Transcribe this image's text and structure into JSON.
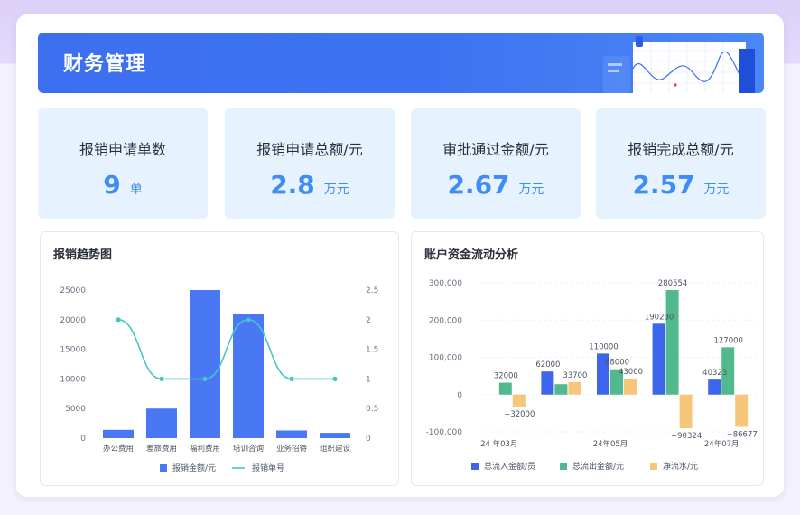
{
  "header": {
    "title": "财务管理"
  },
  "stats": [
    {
      "label": "报销申请单数",
      "value": "9",
      "unit": "单"
    },
    {
      "label": "报销申请总额/元",
      "value": "2.8",
      "unit": "万元"
    },
    {
      "label": "审批通过金额/元",
      "value": "2.67",
      "unit": "万元"
    },
    {
      "label": "报销完成总额/元",
      "value": "2.57",
      "unit": "万元"
    }
  ],
  "colors": {
    "bar_blue": "#4a78f4",
    "line_teal": "#45c6c6",
    "inflow": "#3e66ec",
    "outflow": "#52b98e",
    "net": "#f6c77b",
    "accent_text": "#3f8df3"
  },
  "chart_data": [
    {
      "type": "bar",
      "title": "报销趋势图",
      "categories": [
        "办公费用",
        "差旅费用",
        "福利费用",
        "培训咨询",
        "业务招待",
        "组织建设"
      ],
      "y_left_ticks": [
        "25000",
        "20000",
        "15000",
        "10000",
        "5000",
        "0"
      ],
      "y_right_ticks": [
        "2.5",
        "2",
        "1.5",
        "1",
        "0.5",
        "0"
      ],
      "ylim_left": [
        0,
        25000
      ],
      "ylim_right": [
        0,
        2.5
      ],
      "series": [
        {
          "name": "报销金额/元",
          "kind": "bar",
          "axis": "left",
          "values": [
            1400,
            5000,
            25000,
            21000,
            1300,
            900
          ]
        },
        {
          "name": "报销单号",
          "kind": "line",
          "axis": "right",
          "values": [
            2,
            1,
            1,
            2,
            1,
            1
          ]
        }
      ],
      "legend": "bottom"
    },
    {
      "type": "bar",
      "title": "账户资金流动分析",
      "categories": [
        "24年03月",
        "",
        "24年05月",
        "",
        "24年07月"
      ],
      "x_tick_labels": [
        "24 年03月",
        "24年05月",
        "24年07月"
      ],
      "y_ticks": [
        "300,000",
        "200,000",
        "100,000",
        "0",
        "-100,000"
      ],
      "ylim": [
        -100000,
        300000
      ],
      "series": [
        {
          "name": "总流入金额/员",
          "values": [
            0,
            62000,
            110000,
            190230,
            40323
          ]
        },
        {
          "name": "总流出金额/元",
          "values": [
            32000,
            28000,
            68000,
            280554,
            127000
          ]
        },
        {
          "name": "净流水/元",
          "values": [
            -32000,
            33700,
            43000,
            -90324,
            -86677
          ]
        }
      ],
      "data_labels": [
        {
          "group": 0,
          "series": 1,
          "text": "32000"
        },
        {
          "group": 0,
          "series": 2,
          "text": "−32000"
        },
        {
          "group": 1,
          "series": 0,
          "text": "62000"
        },
        {
          "group": 1,
          "series": 2,
          "text": "33700"
        },
        {
          "group": 2,
          "series": 0,
          "text": "110000"
        },
        {
          "group": 2,
          "series": 1,
          "text": "68000"
        },
        {
          "group": 2,
          "series": 2,
          "text": "43000"
        },
        {
          "group": 3,
          "series": 0,
          "text": "190230"
        },
        {
          "group": 3,
          "series": 1,
          "text": "280554"
        },
        {
          "group": 3,
          "series": 2,
          "text": "−90324"
        },
        {
          "group": 4,
          "series": 0,
          "text": "40323"
        },
        {
          "group": 4,
          "series": 1,
          "text": "127000"
        },
        {
          "group": 4,
          "series": 2,
          "text": "−86677"
        }
      ],
      "legend": "bottom"
    }
  ]
}
